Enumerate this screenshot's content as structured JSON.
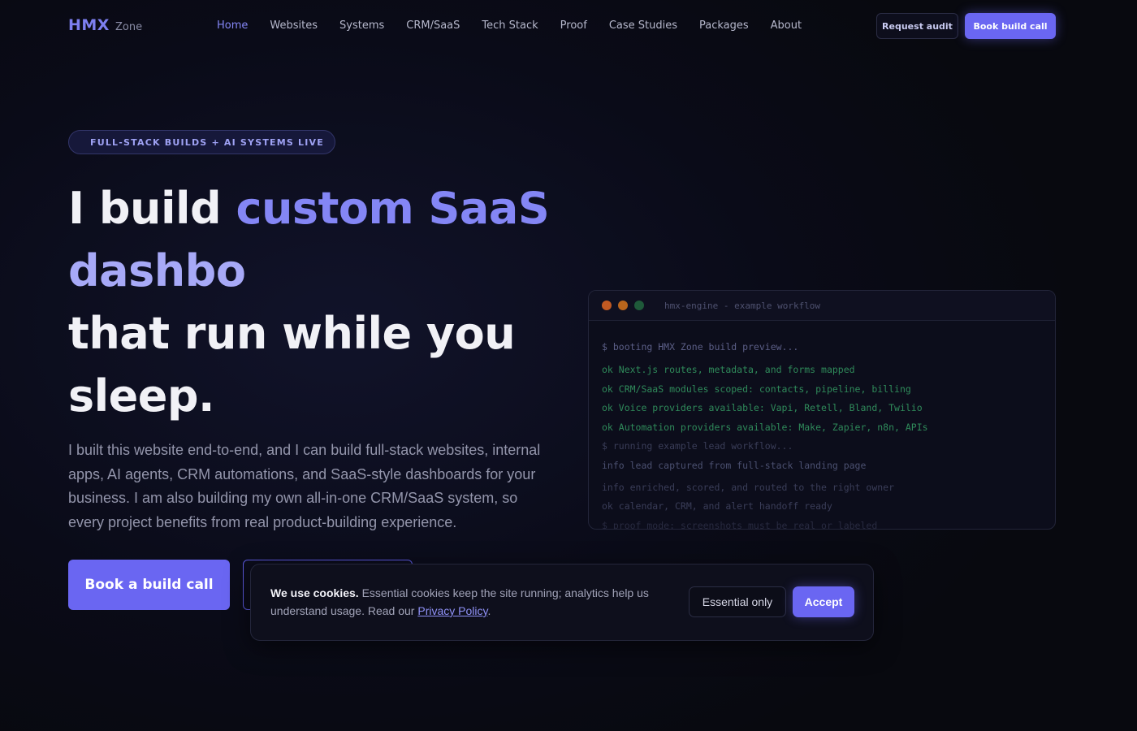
{
  "nav": {
    "brand_main": "HMX",
    "brand_sub": "Zone",
    "links": [
      "Home",
      "Websites",
      "Systems",
      "CRM/SaaS",
      "Tech Stack",
      "Proof",
      "Case Studies",
      "Packages",
      "About"
    ],
    "request_audit": "Request audit",
    "book_build_call": "Book build call"
  },
  "hero": {
    "badge": "FULL-STACK BUILDS + AI SYSTEMS LIVE",
    "title_1": "I build ",
    "title_2": "custom SaaS",
    "title_3": "dashbo",
    "title_4": "that run while you",
    "title_5": "sleep.",
    "description": "I built this website end-to-end, and I can build full-stack websites, internal apps, AI agents, CRM automations, and SaaS-style dashboards for your business. I am also building my own all-in-one CRM/SaaS system, so every project benefits from real product-building experience.",
    "primary_cta": "Book a build call",
    "secondary_cta": ""
  },
  "terminal": {
    "title": "hmx-engine - example workflow",
    "colors": {
      "red": "#c25a22",
      "yellow": "#b8651c",
      "green": "#1f5a3a"
    },
    "lines": [
      {
        "text": "$ booting HMX Zone build preview...",
        "kind": "cmd"
      },
      {
        "text": "ok Next.js routes, metadata, and forms mapped",
        "kind": "ok"
      },
      {
        "text": "ok CRM/SaaS modules scoped: contacts, pipeline, billing",
        "kind": "ok"
      },
      {
        "text": "ok Voice providers available: Vapi, Retell, Bland, Twilio",
        "kind": "ok"
      },
      {
        "text": "ok Automation providers available: Make, Zapier, n8n, APIs",
        "kind": "ok"
      },
      {
        "text": "$ running example lead workflow...",
        "kind": "dim"
      },
      {
        "text": "info lead captured from full-stack landing page",
        "kind": "info"
      },
      {
        "text": "info enriched, scored, and routed to the right owner",
        "kind": "dim"
      },
      {
        "text": "ok calendar, CRM, and alert handoff ready",
        "kind": "dim"
      },
      {
        "text": "$ proof mode: screenshots must be real or labeled",
        "kind": "faint"
      }
    ]
  },
  "cookie": {
    "bold": "We use cookies.",
    "text": " Essential cookies keep the site running; analytics help us understand usage. Read our ",
    "link": "Privacy Policy",
    "tail": ".",
    "essential_btn": "Essential only",
    "accept_btn": "Accept"
  }
}
